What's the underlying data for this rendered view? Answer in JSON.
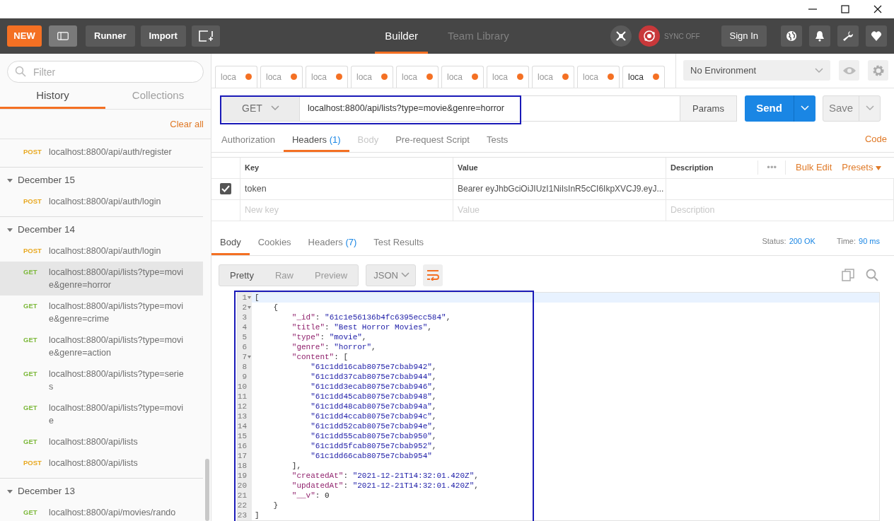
{
  "header": {
    "new_button": "NEW",
    "runner_button": "Runner",
    "import_button": "Import",
    "nav": [
      {
        "label": "Builder",
        "selected": true
      },
      {
        "label": "Team Library",
        "selected": false
      }
    ],
    "sync": "SYNC OFF",
    "sign_in": "Sign In"
  },
  "sidebar": {
    "filter_placeholder": "Filter",
    "tabs": [
      {
        "label": "History",
        "selected": true
      },
      {
        "label": "Collections",
        "selected": false
      }
    ],
    "clear_all": "Clear all",
    "groups": [
      {
        "items": [
          {
            "method": "POST",
            "url": "localhost:8800/api/auth/register",
            "selected": false
          }
        ]
      },
      {
        "date": "December 15",
        "expanded": true,
        "items": [
          {
            "method": "POST",
            "url": "localhost:8800/api/auth/login",
            "selected": false
          }
        ]
      },
      {
        "date": "December 14",
        "expanded": true,
        "items": [
          {
            "method": "POST",
            "url": "localhost:8800/api/auth/login",
            "selected": false
          },
          {
            "method": "GET",
            "url": "localhost:8800/api/lists?type=movie&genre=horror",
            "selected": true
          },
          {
            "method": "GET",
            "url": "localhost:8800/api/lists?type=movie&genre=crime",
            "selected": false
          },
          {
            "method": "GET",
            "url": "localhost:8800/api/lists?type=movie&genre=action",
            "selected": false
          },
          {
            "method": "GET",
            "url": "localhost:8800/api/lists?type=series",
            "selected": false
          },
          {
            "method": "GET",
            "url": "localhost:8800/api/lists?type=movie",
            "selected": false
          },
          {
            "method": "GET",
            "url": "localhost:8800/api/lists",
            "selected": false
          },
          {
            "method": "POST",
            "url": "localhost:8800/api/lists",
            "selected": false
          }
        ]
      },
      {
        "date": "December 13",
        "expanded": true,
        "items": [
          {
            "method": "GET",
            "url": "localhost:8800/api/movies/rando",
            "selected": false
          }
        ]
      }
    ]
  },
  "request_tabs": [
    {
      "label": "loca",
      "unsaved": true,
      "selected": false
    },
    {
      "label": "loca",
      "unsaved": true,
      "selected": false
    },
    {
      "label": "loca",
      "unsaved": true,
      "selected": false
    },
    {
      "label": "loca",
      "unsaved": true,
      "selected": false
    },
    {
      "label": "loca",
      "unsaved": true,
      "selected": false
    },
    {
      "label": "loca",
      "unsaved": true,
      "selected": false
    },
    {
      "label": "loca",
      "unsaved": true,
      "selected": false
    },
    {
      "label": "loca",
      "unsaved": true,
      "selected": false
    },
    {
      "label": "loca",
      "unsaved": true,
      "selected": false
    },
    {
      "label": "loca",
      "unsaved": true,
      "selected": true
    }
  ],
  "environment": "No Environment",
  "request": {
    "method": "GET",
    "url": "localhost:8800/api/lists?type=movie&genre=horror",
    "highlighted": true,
    "params": "Params",
    "send": "Send",
    "save": "Save"
  },
  "request_sections": [
    {
      "label": "Authorization",
      "selected": false,
      "disabled": false
    },
    {
      "label": "Headers",
      "count": "(1)",
      "selected": true,
      "disabled": false
    },
    {
      "label": "Body",
      "selected": false,
      "disabled": true
    },
    {
      "label": "Pre-request Script",
      "selected": false,
      "disabled": false
    },
    {
      "label": "Tests",
      "selected": false,
      "disabled": false
    }
  ],
  "code_link": "Code",
  "headers_table": {
    "columns": [
      "Key",
      "Value",
      "Description"
    ],
    "more": "•••",
    "bulk_edit": "Bulk Edit",
    "presets": "Presets",
    "rows": [
      {
        "checked": true,
        "key": "token",
        "value": "Bearer eyJhbGciOiJIUzI1NiIsInR5cCI6IkpXVCJ9.eyJ..."
      }
    ],
    "new_row": {
      "key_placeholder": "New key",
      "value_placeholder": "Value",
      "description_placeholder": "Description"
    }
  },
  "response": {
    "tabs": [
      {
        "label": "Body",
        "selected": true
      },
      {
        "label": "Cookies",
        "selected": false
      },
      {
        "label": "Headers",
        "count": "(7)",
        "selected": false
      },
      {
        "label": "Test Results",
        "selected": false
      }
    ],
    "status_label": "Status:",
    "status": "200 OK",
    "time_label": "Time:",
    "time": "90 ms",
    "view_modes": [
      {
        "label": "Pretty",
        "selected": true
      },
      {
        "label": "Raw",
        "selected": false
      },
      {
        "label": "Preview",
        "selected": false
      }
    ],
    "format": "JSON",
    "editor": {
      "highlighted": true,
      "lines": [
        {
          "number": "1",
          "fold": true,
          "active": true,
          "text": "["
        },
        {
          "number": "2",
          "fold": true,
          "active": false,
          "text": "    {"
        },
        {
          "number": "3",
          "fold": false,
          "active": false,
          "text": "        \"_id\": \"61c1e56136b4fc6395ecc584\","
        },
        {
          "number": "4",
          "fold": false,
          "active": false,
          "text": "        \"title\": \"Best Horror Movies\","
        },
        {
          "number": "5",
          "fold": false,
          "active": false,
          "text": "        \"type\": \"movie\","
        },
        {
          "number": "6",
          "fold": false,
          "active": false,
          "text": "        \"genre\": \"horror\","
        },
        {
          "number": "7",
          "fold": true,
          "active": false,
          "text": "        \"content\": ["
        },
        {
          "number": "8",
          "fold": false,
          "active": false,
          "text": "            \"61c1dd16cab8075e7cbab942\","
        },
        {
          "number": "9",
          "fold": false,
          "active": false,
          "text": "            \"61c1dd37cab8075e7cbab944\","
        },
        {
          "number": "10",
          "fold": false,
          "active": false,
          "text": "            \"61c1dd3ecab8075e7cbab946\","
        },
        {
          "number": "11",
          "fold": false,
          "active": false,
          "text": "            \"61c1dd45cab8075e7cbab948\","
        },
        {
          "number": "12",
          "fold": false,
          "active": false,
          "text": "            \"61c1dd48cab8075e7cbab94a\","
        },
        {
          "number": "13",
          "fold": false,
          "active": false,
          "text": "            \"61c1dd4ccab8075e7cbab94c\","
        },
        {
          "number": "14",
          "fold": false,
          "active": false,
          "text": "            \"61c1dd52cab8075e7cbab94e\","
        },
        {
          "number": "15",
          "fold": false,
          "active": false,
          "text": "            \"61c1dd55cab8075e7cbab950\","
        },
        {
          "number": "16",
          "fold": false,
          "active": false,
          "text": "            \"61c1dd5fcab8075e7cbab952\","
        },
        {
          "number": "17",
          "fold": false,
          "active": false,
          "text": "            \"61c1dd66cab8075e7cbab954\""
        },
        {
          "number": "18",
          "fold": false,
          "active": false,
          "text": "        ],"
        },
        {
          "number": "19",
          "fold": false,
          "active": false,
          "text": "        \"createdAt\": \"2021-12-21T14:32:01.420Z\","
        },
        {
          "number": "20",
          "fold": false,
          "active": false,
          "text": "        \"updatedAt\": \"2021-12-21T14:32:01.420Z\","
        },
        {
          "number": "21",
          "fold": false,
          "active": false,
          "text": "        \"__v\": 0"
        },
        {
          "number": "22",
          "fold": false,
          "active": false,
          "text": "    }"
        },
        {
          "number": "23",
          "fold": false,
          "active": false,
          "text": "]"
        }
      ]
    }
  }
}
